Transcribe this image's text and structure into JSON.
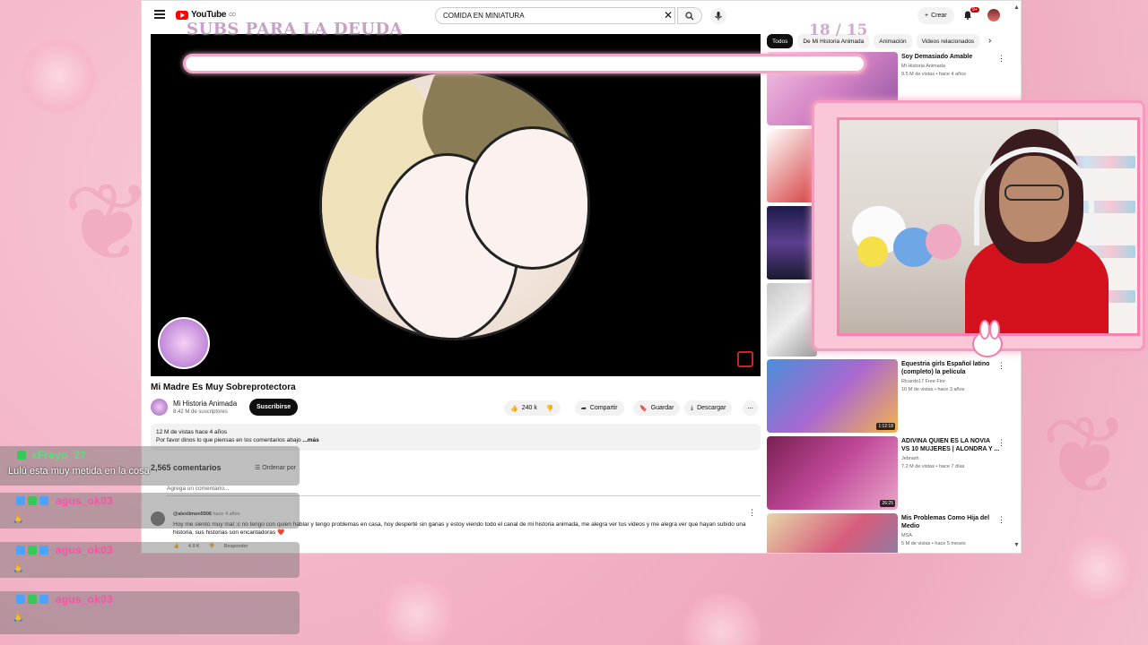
{
  "youtube": {
    "logo_text": "YouTube",
    "logo_country": "CO",
    "search_value": "COMIDA EN MINIATURA",
    "create_label": "Crear",
    "notification_count": "9+"
  },
  "stream_overlay": {
    "goal_label": "SUBS PARA LA DEUDA",
    "goal_counter": "18 / 15"
  },
  "video": {
    "title": "Mi Madre Es Muy Sobreprotectora",
    "channel_name": "Mi Historia Animada",
    "channel_subs": "8.42 M de suscriptores",
    "subscribe_label": "Suscribirse",
    "like_count": "240 k",
    "share_label": "Compartir",
    "save_label": "Guardar",
    "download_label": "Descargar",
    "views_age": "12 M de vistas  hace 4 años",
    "description": "Por favor dinos lo que piensas en los comentarios abajo",
    "more_label": "...más"
  },
  "comments": {
    "count_label": "2,565 comentarios",
    "sort_label": "Ordenar por",
    "add_placeholder": "Agrega un comentario...",
    "first": {
      "author": "@alexlimon5906",
      "time": "hace 4 años",
      "text": "Hoy me siento muy mal :c no tengo con quien hablar y tengo problemas en casa, hoy desperté sin ganas y estoy viendo todo el canal de mi historia animada, me alegra ver tus videos y me alegra ver que hayan subido una historia, sus historias son encantadoras ❤️",
      "likes": "4.9 K",
      "reply_label": "Responder"
    }
  },
  "chips": [
    "Todos",
    "De Mi Historia Animada",
    "Animación",
    "Videos relacionados"
  ],
  "sidebar": [
    {
      "title": "Soy Demasiado Amable",
      "channel": "Mi Historia Animada",
      "meta": "9.5 M de vistas • hace 4 años",
      "duration": ""
    },
    {
      "title": "Equestria girls Español latino (completo) la película",
      "channel": "Ricardo17 Free Fire",
      "meta": "10 M de vistas • hace 3 años",
      "duration": "1:12:18"
    },
    {
      "title": "ADIVINA QUIEN ES LA NOVIA VS 10 MUJERES | ALONDRA Y ...",
      "channel": "Jebrash",
      "meta": "7.2 M de vistas • hace 7 días",
      "duration": "26:25"
    },
    {
      "title": "Mis Problemas Como Hija del Medio",
      "channel": "MSA",
      "meta": "5 M de vistas • hace 5 meses",
      "duration": ""
    }
  ],
  "chat": [
    {
      "name": "xFreyp_27",
      "text": "Lulú esta muy metida en la cosa"
    },
    {
      "name": "agus_ok03",
      "text": ""
    },
    {
      "name": "agus_ok03",
      "text": ""
    },
    {
      "name": "agus_ok03",
      "text": ""
    }
  ],
  "colors": {
    "accent": "#ff0000",
    "overlay_pink": "#f59bbd",
    "chat_name": "#ff4fa6"
  }
}
